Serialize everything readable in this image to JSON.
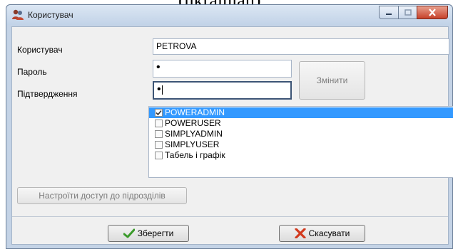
{
  "cutoff_text": "(ukrainian)",
  "window": {
    "title": "Користувач",
    "app_icon": "users-icon",
    "minimize_icon": "minimize-icon",
    "maximize_icon": "maximize-icon",
    "close_icon": "close-icon"
  },
  "form": {
    "user_label": "Користувач",
    "user_value": "PETROVA",
    "password_label": "Пароль",
    "password_value": "•",
    "confirm_label": "Підтвердження",
    "confirm_value": "•",
    "change_button": "Змінити"
  },
  "roles": [
    {
      "label": "POWERADMIN",
      "checked": true,
      "selected": true
    },
    {
      "label": "POWERUSER",
      "checked": false,
      "selected": false
    },
    {
      "label": "SIMPLYADMIN",
      "checked": false,
      "selected": false
    },
    {
      "label": "SIMPLYUSER",
      "checked": false,
      "selected": false
    },
    {
      "label": "Табель і графік",
      "checked": false,
      "selected": false
    }
  ],
  "department_access_button": "Настроїти доступ до підрозділів",
  "footer": {
    "save_label": "Зберегти",
    "save_icon": "checkmark-icon",
    "cancel_label": "Скасувати",
    "cancel_icon": "red-x-icon"
  },
  "colors": {
    "selection": "#3399ff",
    "title_bar": "#c4d3e6",
    "close_button": "#c7412a"
  }
}
